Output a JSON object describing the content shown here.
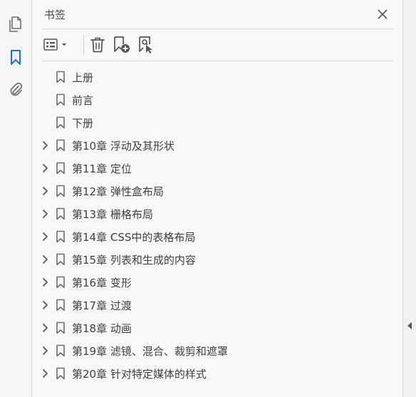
{
  "rail": {
    "items": [
      {
        "name": "pages",
        "icon": "page-thumbnails-icon",
        "active": false
      },
      {
        "name": "bookmarks",
        "icon": "bookmark-icon",
        "active": true
      },
      {
        "name": "attachments",
        "icon": "paperclip-icon",
        "active": false
      }
    ]
  },
  "panel": {
    "title": "书签",
    "close_icon": "close-icon"
  },
  "toolbar": {
    "options_icon": "options-menu-icon",
    "delete_icon": "trash-icon",
    "new_bookmark_icon": "new-bookmark-icon",
    "find_bookmark_icon": "find-current-bookmark-icon"
  },
  "bookmarks": [
    {
      "label": "上册",
      "expandable": false
    },
    {
      "label": "前言",
      "expandable": false
    },
    {
      "label": "下册",
      "expandable": false
    },
    {
      "label": "第10章 浮动及其形状",
      "expandable": true
    },
    {
      "label": "第11章 定位",
      "expandable": true
    },
    {
      "label": "第12章 弹性盒布局",
      "expandable": true
    },
    {
      "label": "第13章 栅格布局",
      "expandable": true
    },
    {
      "label": "第14章 CSS中的表格布局",
      "expandable": true
    },
    {
      "label": "第15章 列表和生成的内容",
      "expandable": true
    },
    {
      "label": "第16章 变形",
      "expandable": true
    },
    {
      "label": "第17章 过渡",
      "expandable": true
    },
    {
      "label": "第18章 动画",
      "expandable": true
    },
    {
      "label": "第19章 滤镜、混合、裁剪和遮罩",
      "expandable": true
    },
    {
      "label": "第20章 针对特定媒体的样式",
      "expandable": true
    }
  ],
  "colors": {
    "accent": "#1473e6",
    "icon": "#6e6e6e"
  }
}
